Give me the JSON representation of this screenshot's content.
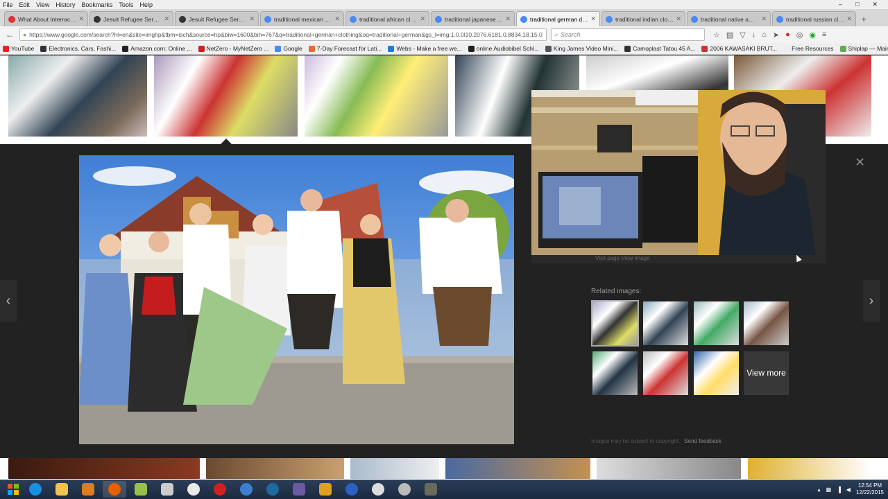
{
  "menu": [
    "File",
    "Edit",
    "View",
    "History",
    "Bookmarks",
    "Tools",
    "Help"
  ],
  "window_controls": [
    "–",
    "□",
    "✕"
  ],
  "tabs": [
    {
      "label": "What About Interracia...",
      "fav": "#d33",
      "active": false
    },
    {
      "label": "Jesuit Refugee Service ...",
      "fav": "#333",
      "active": false
    },
    {
      "label": "Jesuit Refugee Service ...",
      "fav": "#333",
      "active": false
    },
    {
      "label": "traditional mexican dr...",
      "fav": "#4a8af4",
      "active": false
    },
    {
      "label": "traditional african clot...",
      "fav": "#4a8af4",
      "active": false
    },
    {
      "label": "traditional japanese w...",
      "fav": "#4a8af4",
      "active": false
    },
    {
      "label": "traditional german da...",
      "fav": "#4a8af4",
      "active": true
    },
    {
      "label": "traditional indian clot...",
      "fav": "#4a8af4",
      "active": false
    },
    {
      "label": "traditional native ame...",
      "fav": "#4a8af4",
      "active": false
    },
    {
      "label": "traditional russian clot...",
      "fav": "#4a8af4",
      "active": false
    }
  ],
  "nav": {
    "url": "https://www.google.com/search?hl=en&site=imghp&tbm=isch&source=hp&biw=1600&bih=767&q=traditional+german+clothing&oq=traditional+german&gs_l=img.1.0.0l10.2076.6181.0.8834.18.15.0",
    "search_placeholder": "Search",
    "back_icon": "←",
    "reload_icon": "↻"
  },
  "bookmarks": [
    {
      "label": "YouTube",
      "color": "#e22"
    },
    {
      "label": "Electronics, Cars, Fashi...",
      "color": "#333"
    },
    {
      "label": "Amazon.com: Online ...",
      "color": "#222"
    },
    {
      "label": "NetZero - MyNetZero ...",
      "color": "#c22"
    },
    {
      "label": "Google",
      "color": "#4a8af4"
    },
    {
      "label": "7-Day Forecast for Lati...",
      "color": "#e63"
    },
    {
      "label": "Webs - Make a free we...",
      "color": "#1a7fd0"
    },
    {
      "label": "online Audiobibel Schl...",
      "color": "#222"
    },
    {
      "label": "King James Video Mini...",
      "color": "#555"
    },
    {
      "label": "Camoplast Tatou 45 A...",
      "color": "#333"
    },
    {
      "label": "2006 KAWASAKI BRUT...",
      "color": "#c33"
    },
    {
      "label": "Free Resources",
      "color": "#eee"
    },
    {
      "label": "Shiplap — Maine Ceda...",
      "color": "#6a5"
    }
  ],
  "preview": {
    "related_label": "Related images:",
    "view_more": "View more",
    "copyright": "Images may be subject to copyright.",
    "send_feedback": "Send feedback",
    "webcam_strip": "Visit page    View image",
    "prev_arrow": "‹",
    "next_arrow": "›",
    "close": "✕"
  },
  "taskbar": {
    "time": "12:54 PM",
    "date": "12/22/2015"
  }
}
